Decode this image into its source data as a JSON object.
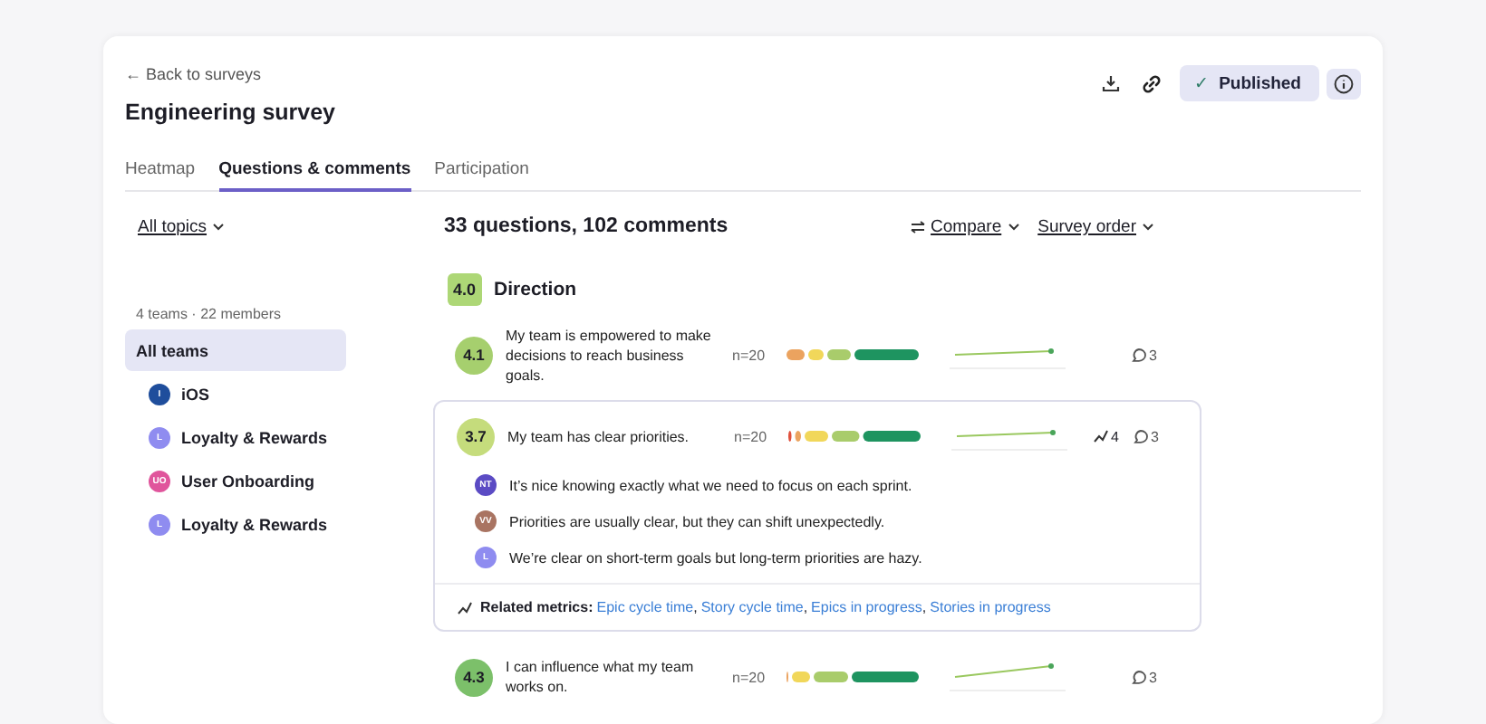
{
  "header": {
    "back_link": "← Back to surveys",
    "title": "Engineering survey",
    "status": "Published",
    "status_mark": "✓"
  },
  "tabs": [
    {
      "label": "Heatmap",
      "selected": false
    },
    {
      "label": "Questions & comments",
      "selected": true
    },
    {
      "label": "Participation",
      "selected": false
    }
  ],
  "sidebar": {
    "filter": "All topics",
    "summary": "4 teams · 22 members",
    "items": [
      {
        "label": "All teams",
        "selected": true
      },
      {
        "label": "iOS",
        "initials": "I",
        "color": "#1f4e9c",
        "selected": false
      },
      {
        "label": "Loyalty & Rewards",
        "initials": "L",
        "color": "#8f8cf0",
        "selected": false
      },
      {
        "label": "User Onboarding",
        "initials": "UO",
        "color": "#e0559c",
        "selected": false
      },
      {
        "label": "Loyalty & Rewards",
        "initials": "L",
        "color": "#8f8cf0",
        "selected": false
      }
    ]
  },
  "main": {
    "heading": "33 questions, 102 comments",
    "compare": "Compare",
    "sort": "Survey order",
    "section": {
      "score": "4.0",
      "title": "Direction"
    },
    "questions": [
      {
        "score": "4.1",
        "color": "#a6cf6e",
        "text": "My team is empowered to make decisions to reach business goals.",
        "n": "n=20",
        "expanded": false,
        "comments_count": "3"
      },
      {
        "score": "3.7",
        "color": "#c5dc7c",
        "text": "My team has clear priorities.",
        "n": "n=20",
        "expanded": true,
        "metrics": "4",
        "comments_count": "3",
        "comments": [
          {
            "initials": "NT",
            "color": "#5b4bc4",
            "text": "It’s nice knowing exactly what we need to focus on each sprint."
          },
          {
            "initials": "VV",
            "color": "#a97462",
            "text": "Priorities are usually clear, but they can shift unexpectedly."
          },
          {
            "initials": "L",
            "color": "#8f8cf0",
            "text": "We’re clear on short-term goals but long-term priorities are hazy."
          }
        ],
        "related_label": "Related metrics:",
        "separator": ",",
        "related": [
          "Epic cycle time",
          "Story cycle time",
          "Epics in progress",
          "Stories in progress"
        ]
      },
      {
        "score": "4.3",
        "color": "#7cc06a",
        "text": "I can influence what my team works on.",
        "n": "n=20",
        "expanded": false,
        "comments_count": "3"
      }
    ]
  }
}
